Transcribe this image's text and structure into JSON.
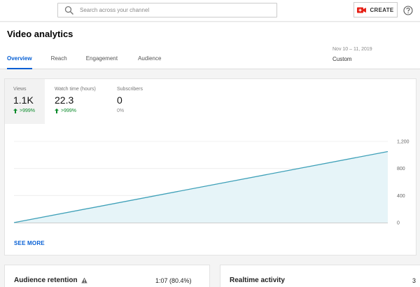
{
  "topbar": {
    "search_placeholder": "Search across your channel",
    "create_label": "CREATE",
    "icons": {
      "search": "search-icon",
      "create": "video-camera-plus-icon",
      "help": "help-icon"
    }
  },
  "header": {
    "title": "Video analytics",
    "tabs": [
      {
        "label": "Overview",
        "active": true
      },
      {
        "label": "Reach",
        "active": false
      },
      {
        "label": "Engagement",
        "active": false
      },
      {
        "label": "Audience",
        "active": false
      }
    ],
    "date_range": "Nov 10 – 11, 2019",
    "date_preset": "Custom"
  },
  "metrics": [
    {
      "label": "Views",
      "value": "1.1K",
      "change": ">999%",
      "trend": "up",
      "selected": true
    },
    {
      "label": "Watch time (hours)",
      "value": "22.3",
      "change": ">999%",
      "trend": "up",
      "selected": false
    },
    {
      "label": "Subscribers",
      "value": "0",
      "change": "0%",
      "trend": "neutral",
      "selected": false
    }
  ],
  "colors": {
    "accent": "#065fd4",
    "line": "#3ea0b8",
    "fill": "#e6f4f8",
    "positive": "#0a8a2a"
  },
  "chart_data": {
    "type": "area",
    "x": [
      0,
      1
    ],
    "values": [
      0,
      1050
    ],
    "ylim": [
      0,
      1200
    ],
    "yticks": [
      "0",
      "400",
      "800",
      "1,200"
    ],
    "ytick_values": [
      0,
      400,
      800,
      1200
    ],
    "grid": true
  },
  "see_more_label": "SEE MORE",
  "audience_retention": {
    "title": "Audience retention",
    "value": "1:07 (80.4%)"
  },
  "realtime": {
    "title": "Realtime activity",
    "value": "3"
  }
}
